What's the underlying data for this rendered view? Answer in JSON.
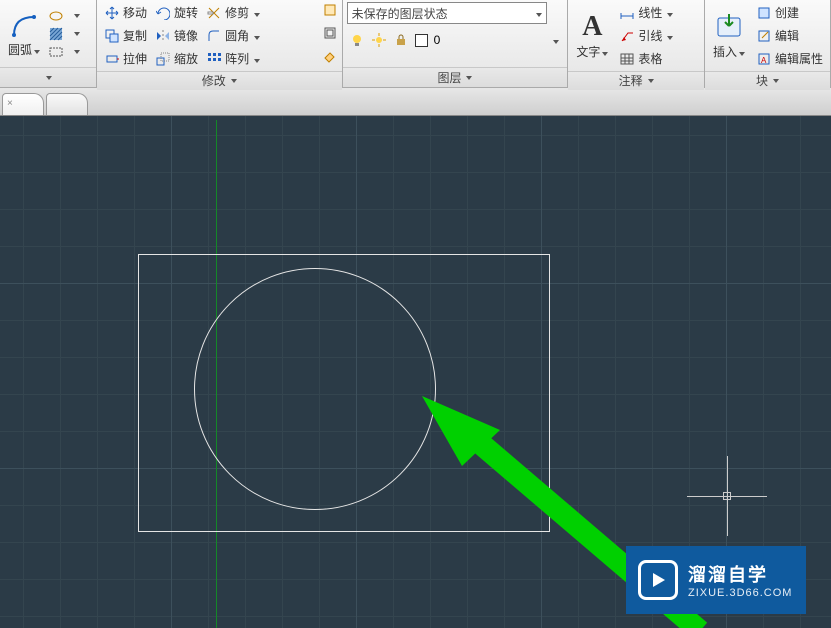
{
  "ribbon": {
    "panels": {
      "draw_label": "",
      "modify_label": "修改",
      "layer_label": "图层",
      "annotate_label": "注释",
      "block_label": "块"
    },
    "draw": {
      "arc": "圆弧"
    },
    "modify": {
      "move": "移动",
      "rotate": "旋转",
      "trim": "修剪",
      "copy": "复制",
      "mirror": "镜像",
      "fillet": "圆角",
      "stretch": "拉伸",
      "scale": "缩放",
      "array": "阵列"
    },
    "layer": {
      "state_combo": "未保存的图层状态",
      "current": "0"
    },
    "annotate": {
      "text": "文字",
      "lines": "线性",
      "leader": "引线",
      "table": "表格"
    },
    "block": {
      "insert": "插入",
      "create": "创建",
      "edit": "编辑",
      "editattr": "编辑属性"
    }
  },
  "watermark": {
    "title": "溜溜自学",
    "url": "ZIXUE.3D66.COM"
  }
}
